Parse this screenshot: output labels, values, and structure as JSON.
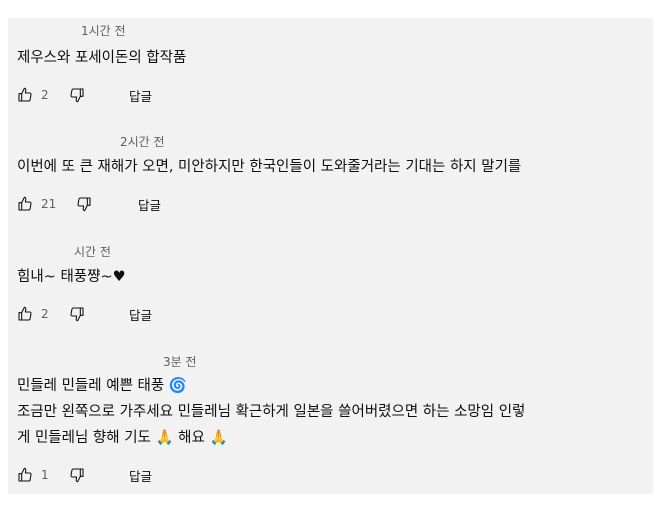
{
  "comments": [
    {
      "time": "1시간 전",
      "lines": [
        "제우스와 포세이돈의 합작품"
      ],
      "likes": "2",
      "reply_label": "답글"
    },
    {
      "time": "2시간 전",
      "lines": [
        "이번에 또 큰 재해가 오면, 미안하지만 한국인들이 도와줄거라는 기대는 하지 말기를"
      ],
      "likes": "21",
      "reply_label": "답글"
    },
    {
      "time": "시간 전",
      "lines": [
        "힘내~ 태풍쨩~♥"
      ],
      "likes": "2",
      "reply_label": "답글"
    },
    {
      "time": "3분 전",
      "lines": [
        "민들레 민들레 예쁜 태풍 🌀",
        "조금만 왼쪽으로 가주세요 민들레님 확근하게 일본을 쓸어버렸으면 하는 소망임 인렇",
        "게 민들레님 향해 기도 🙏 해요 🙏"
      ],
      "likes": "1",
      "reply_label": "답글"
    }
  ]
}
